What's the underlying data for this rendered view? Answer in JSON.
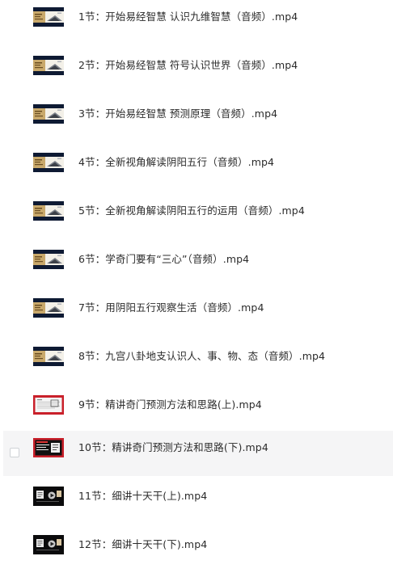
{
  "files": [
    {
      "name": "1节：开始易经智慧 认识九维智慧（音频）.mp4",
      "thumb": "audio-slide",
      "hovered": false
    },
    {
      "name": "2节：开始易经智慧 符号认识世界（音频）.mp4",
      "thumb": "audio-slide",
      "hovered": false
    },
    {
      "name": "3节：开始易经智慧 预测原理（音频）.mp4",
      "thumb": "audio-slide",
      "hovered": false
    },
    {
      "name": "4节：全新视角解读阴阳五行（音频）.mp4",
      "thumb": "audio-slide",
      "hovered": false
    },
    {
      "name": "5节：全新视角解读阴阳五行的运用（音频）.mp4",
      "thumb": "audio-slide",
      "hovered": false
    },
    {
      "name": "6节：学奇门要有“三心”（音频）.mp4",
      "thumb": "audio-slide",
      "hovered": false
    },
    {
      "name": "7节：用阴阳五行观察生活（音频）.mp4",
      "thumb": "audio-slide",
      "hovered": false
    },
    {
      "name": "8节：九宫八卦地支认识人、事、物、态（音频）.mp4",
      "thumb": "audio-slide",
      "hovered": false
    },
    {
      "name": "9节：精讲奇门预测方法和思路(上).mp4",
      "thumb": "red-doc",
      "hovered": false
    },
    {
      "name": "10节：精讲奇门预测方法和思路(下).mp4",
      "thumb": "red-dark",
      "hovered": true
    },
    {
      "name": "11节：细讲十天干(上).mp4",
      "thumb": "dark-video",
      "hovered": false
    },
    {
      "name": "12节：细讲十天干(下).mp4",
      "thumb": "dark-video",
      "hovered": false
    }
  ],
  "colors": {
    "hover_background": "#f5f5f6",
    "text": "#2b2b2b",
    "checkbox_border": "#cfd2d6"
  },
  "icons": {
    "checkbox": "checkbox-icon",
    "video": "video-thumbnail-icon"
  }
}
